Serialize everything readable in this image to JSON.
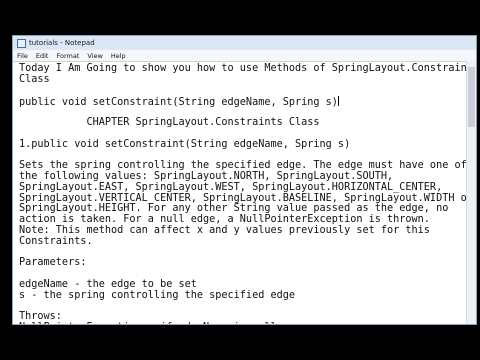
{
  "window": {
    "title": "tutorials - Notepad"
  },
  "menu": [
    "File",
    "Edit",
    "Format",
    "View",
    "Help"
  ],
  "lines": [
    "Today I Am Going to show you how to use Methods of SpringLayout.Constraints",
    "Class",
    "",
    "public void setConstraint(String edgeName, Spring s)",
    "",
    "           CHAPTER SpringLayout.Constraints Class",
    "",
    "1.public void setConstraint(String edgeName, Spring s)",
    "",
    "Sets the spring controlling the specified edge. The edge must have one of",
    "the following values: SpringLayout.NORTH, SpringLayout.SOUTH,",
    "SpringLayout.EAST, SpringLayout.WEST, SpringLayout.HORIZONTAL_CENTER,",
    "SpringLayout.VERTICAL_CENTER, SpringLayout.BASELINE, SpringLayout.WIDTH or",
    "SpringLayout.HEIGHT. For any other String value passed as the edge, no",
    "action is taken. For a null edge, a NullPointerException is thrown.",
    "Note: This method can affect x and y values previously set for this",
    "Constraints.",
    "",
    "Parameters:",
    "",
    "edgeName - the edge to be set",
    "s - the spring controlling the specified edge",
    "",
    "Throws:",
    "NullPointerException - if edgeName is null"
  ]
}
